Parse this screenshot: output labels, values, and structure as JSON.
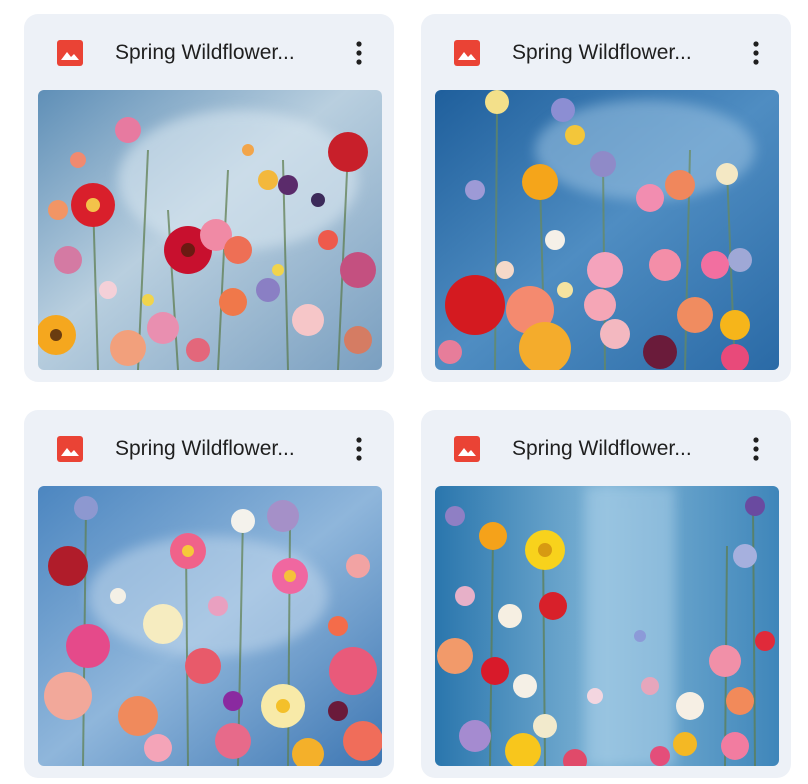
{
  "files": [
    {
      "title": "Spring Wildflower...",
      "icon": "image-file-icon",
      "menu_icon": "more-vert-icon",
      "thumbnail": "wildflower-thumbnail-1"
    },
    {
      "title": "Spring Wildflower...",
      "icon": "image-file-icon",
      "menu_icon": "more-vert-icon",
      "thumbnail": "wildflower-thumbnail-2"
    },
    {
      "title": "Spring Wildflower...",
      "icon": "image-file-icon",
      "menu_icon": "more-vert-icon",
      "thumbnail": "wildflower-thumbnail-3"
    },
    {
      "title": "Spring Wildflower...",
      "icon": "image-file-icon",
      "menu_icon": "more-vert-icon",
      "thumbnail": "wildflower-thumbnail-4"
    }
  ],
  "colors": {
    "card_background": "#edf1f7",
    "icon_red": "#ea4335",
    "title_text": "#1f1f1f"
  }
}
